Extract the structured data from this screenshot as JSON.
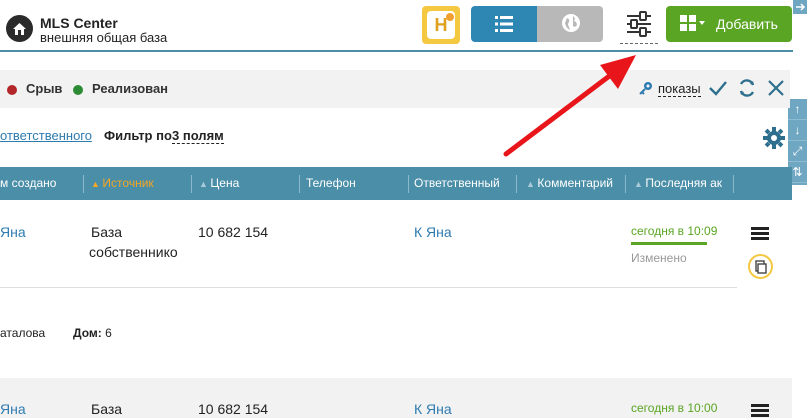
{
  "header": {
    "title": "MLS Center",
    "subtitle": "внешняя общая база",
    "h_button_letter": "H",
    "add_label": "Добавить"
  },
  "status": {
    "items": [
      {
        "label": "Срыв",
        "color": "#b3262a"
      },
      {
        "label": "Реализован",
        "color": "#2e8b35"
      }
    ],
    "shows_label": "показы"
  },
  "filters": {
    "responsible_link": "ответственного",
    "filter_label": "Фильтр по",
    "filter_value": "3 полям"
  },
  "table": {
    "columns": [
      "м создано",
      "Источник",
      "Цена",
      "Телефон",
      "Ответственный",
      "Комментарий",
      "Последняя ак"
    ],
    "active_column_color": "#f5a623",
    "rows": [
      {
        "created": "Яна",
        "source_line1": "База",
        "source_line2": "собственнико",
        "price": "10 682 154",
        "responsible": "К Яна",
        "last_action": "сегодня в 10:09",
        "last_status": "Изменено"
      },
      {
        "created": "Яна",
        "source_line1": "База",
        "price": "10 682 154",
        "responsible": "К Яна",
        "last_action": "сегодня в 10:00"
      }
    ],
    "detail": {
      "street": "аталова",
      "house_label": "Дом:",
      "house_value": "6"
    }
  },
  "rail": {
    "icons": [
      "arrow-up-icon",
      "arrow-down-icon",
      "expand-icon",
      "swap-icon"
    ]
  },
  "annotation": {
    "arrow_color": "#e8161b"
  }
}
